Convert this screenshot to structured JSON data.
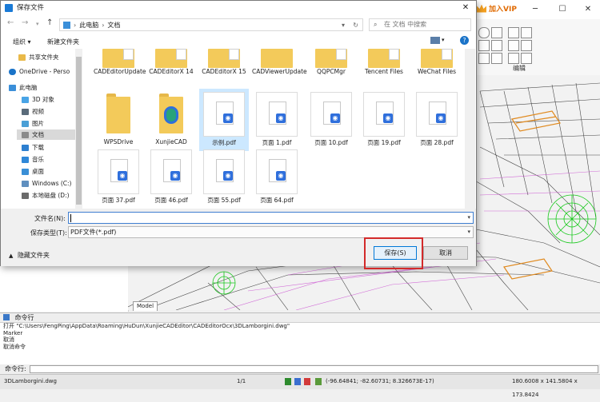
{
  "app": {
    "vip_label": "加入VIP",
    "ribbon_group_label": "编辑",
    "model_tab": "Model",
    "command_panel_title": "命令行",
    "command_output": [
      "打开 \"C:\\Users\\FengPing\\AppData\\Roaming\\HuDun\\XunjieCADEditor\\CADEditorOcx\\3DLamborgini.dwg\"",
      "Marker",
      "取消",
      "取消命令"
    ],
    "command_prompt_label": "命令行:",
    "status": {
      "file": "3DLamborgini.dwg",
      "pages": "1/1",
      "coords": "(-96.64841; -82.60731; 8.326673E-17)",
      "dims": "180.6008 x 141.5804 x 173.8424"
    }
  },
  "dialog": {
    "title": "保存文件",
    "close_icon": "close-icon",
    "breadcrumb": [
      "此电脑",
      "文档"
    ],
    "search_placeholder": "在 文档 中搜索",
    "toolbar": {
      "organize": "组织 ▾",
      "new_folder": "新建文件夹"
    },
    "sidebar": [
      {
        "label": "共享文件夹",
        "icon": "folder-icon",
        "color": "#e9b949"
      },
      {
        "label": "OneDrive - Perso",
        "icon": "cloud-icon",
        "color": "#1a73c8"
      },
      {
        "label": "此电脑",
        "icon": "computer-icon",
        "color": "#3b8fd9"
      },
      {
        "label": "3D 对象",
        "icon": "cube-icon",
        "color": "#49a4e6"
      },
      {
        "label": "视频",
        "icon": "video-icon",
        "color": "#5a6b7a"
      },
      {
        "label": "图片",
        "icon": "picture-icon",
        "color": "#4a9fd6"
      },
      {
        "label": "文档",
        "icon": "document-icon",
        "color": "#8a8a8a"
      },
      {
        "label": "下载",
        "icon": "download-icon",
        "color": "#2d7fd0"
      },
      {
        "label": "音乐",
        "icon": "music-icon",
        "color": "#2f88d8"
      },
      {
        "label": "桌面",
        "icon": "desktop-icon",
        "color": "#3a8fd6"
      },
      {
        "label": "Windows (C:)",
        "icon": "drive-icon",
        "color": "#5f8fbf"
      },
      {
        "label": "本地磁盘 (D:)",
        "icon": "drive-icon",
        "color": "#6b6b6b"
      }
    ],
    "files": [
      {
        "name": "CADEditorUpdate",
        "type": "folder"
      },
      {
        "name": "CADEditorX 14",
        "type": "folder"
      },
      {
        "name": "CADEditorX 15",
        "type": "folder"
      },
      {
        "name": "CADViewerUpdate",
        "type": "folder"
      },
      {
        "name": "QQPCMgr",
        "type": "folder"
      },
      {
        "name": "Tencent Files",
        "type": "folder"
      },
      {
        "name": "WeChat Files",
        "type": "folder"
      },
      {
        "name": "WPSDrive",
        "type": "folder"
      },
      {
        "name": "XunjieCAD",
        "type": "folder"
      },
      {
        "name": "示例.pdf",
        "type": "pdf"
      },
      {
        "name": "页面 1.pdf",
        "type": "pdf"
      },
      {
        "name": "页面 10.pdf",
        "type": "pdf"
      },
      {
        "name": "页面 19.pdf",
        "type": "pdf"
      },
      {
        "name": "页面 28.pdf",
        "type": "pdf"
      },
      {
        "name": "页面 37.pdf",
        "type": "pdf"
      },
      {
        "name": "页面 46.pdf",
        "type": "pdf"
      },
      {
        "name": "页面 55.pdf",
        "type": "pdf"
      },
      {
        "name": "页面 64.pdf",
        "type": "pdf"
      }
    ],
    "filename_label": "文件名(N):",
    "filename_value": "",
    "filetype_label": "保存类型(T):",
    "filetype_value": "PDF文件(*.pdf)",
    "hide_folders": "隐藏文件夹",
    "save_button": "保存(S)",
    "cancel_button": "取消"
  }
}
